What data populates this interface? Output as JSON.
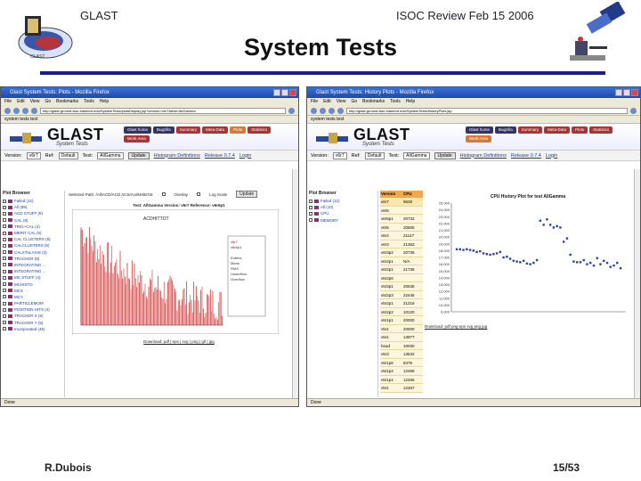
{
  "slide": {
    "header_left": "GLAST",
    "header_right": "ISOC Review Feb 15 2006",
    "title": "System Tests",
    "footer_author": "R.Dubois",
    "footer_page": "15/53"
  },
  "window1": {
    "title": "Glast System Tests: Plots - Mozilla Firefox",
    "menu": [
      "File",
      "Edit",
      "View",
      "Go",
      "Bookmarks",
      "Tools",
      "Help"
    ],
    "address": "http://glast-ground.slac.stanford.edu/SystemTests/plotsDisplay.jsp?version=v6r7&test=AllGamma",
    "bookmarks": "system tests test",
    "logo": "GLAST",
    "subtitle": "System Tests",
    "tabs": [
      "Glast home",
      "Bugzilla",
      "Summary",
      "Meta-Data",
      "Plots",
      "Statistics",
      "Work Area"
    ],
    "active_tab": "Plots",
    "controls": {
      "version_label": "Version:",
      "version_value": "v6r7",
      "ref_label": "Ref:",
      "ref_value": "Default",
      "test_label": "Test:",
      "test_value": "AllGamma",
      "update_button": "Update",
      "histo_link": "Histogram Definitions",
      "release_link": "Release 0.7.4",
      "login_link": "Login"
    },
    "browser_title": "Plot Browser",
    "browser_items": [
      "Failed (12)",
      "All (99)",
      "ACD STUFF (8)",
      "CAL (8)",
      "TRIG+CAL (4)",
      "MERIT CAL (5)",
      "CAL CLUSTERS (8)",
      "CALCLUSTERS (5)",
      "CALXTALAXIS (3)",
      "TRACKER (8)",
      "INTEGRATING ...",
      "INTEGRATING ...",
      "MC STUFF (4)",
      "MCHISTO",
      "MCX",
      "MCY",
      "PARTICLEMOM",
      "POSITION HITS (4)",
      "TRACKER X (5)",
      "TRACKER Y (5)",
      "Incorporated (45)"
    ],
    "selected_row": "Selected Path: /All/ACD/ACD ACS/AcdNHitsTot",
    "overlay_label": "Overlay",
    "logscale_label": "Log Scale",
    "update2_button": "Update",
    "plot_title": "Test: AllGamma  Version: v6r7  Reference: v6r6p1",
    "hist_name": "ACDHITTOT",
    "stats_labels": [
      "v6r7",
      "v6r6p1",
      "Entries",
      "Mean",
      "RMS",
      "Underflow",
      "Overflow"
    ],
    "download_text": "Download: pdf | eps | svg | png | gif | jpg",
    "status": "Done"
  },
  "window2": {
    "title": "Glast System Tests: History Plots - Mozilla Firefox",
    "menu": [
      "File",
      "Edit",
      "View",
      "Go",
      "Bookmarks",
      "Tools",
      "Help"
    ],
    "address": "http://glast-ground.slac.stanford.edu/SystemTests/historyPlots.jsp",
    "bookmarks": "system tests test",
    "logo": "GLAST",
    "subtitle": "System Tests",
    "tabs": [
      "Glast home",
      "Bugzilla",
      "Summary",
      "Meta-Data",
      "Plots",
      "Statistics",
      "Work Area"
    ],
    "active_tab": "Work Area",
    "controls": {
      "version_label": "Version:",
      "version_value": "v6r7",
      "ref_label": "Ref:",
      "ref_value": "Default",
      "test_label": "Test:",
      "test_value": "AllGamma",
      "update_button": "Update",
      "histo_link": "Histogram Definitions",
      "release_link": "Release 0.7.4",
      "login_link": "Login"
    },
    "browser_title": "Plot Browser",
    "browser_items": [
      "Failed (12)",
      "All (10)",
      "CPU",
      "MEMORY"
    ],
    "table_headers": [
      "Version",
      "CPU"
    ],
    "table_rows": [
      [
        "v6r7",
        "9628"
      ],
      [
        "v6r6",
        ""
      ],
      [
        "v6r5p1",
        "20732"
      ],
      [
        "v6r5",
        "20505"
      ],
      [
        "v6r4",
        "21147"
      ],
      [
        "v6r3",
        "21362"
      ],
      [
        "v6r3p2",
        "20736"
      ],
      [
        "v6r4p1",
        "N/A"
      ],
      [
        "v6r2p1",
        "21735"
      ],
      [
        "v6r2p6",
        ""
      ],
      [
        "v5r2p1",
        "20636"
      ],
      [
        "v5r2p3",
        "22446"
      ],
      [
        "v5r2p1",
        "21216"
      ],
      [
        "v5r2p2",
        "10120"
      ],
      [
        "v5r1p1",
        "20000"
      ],
      [
        "v5r1",
        "20000"
      ],
      [
        "v5r1",
        "13977"
      ],
      [
        "head",
        "10030"
      ],
      [
        "v5r3",
        "13632"
      ],
      [
        "v5r1p6",
        "8476"
      ],
      [
        "v5r1p4",
        "12466"
      ],
      [
        "v5r1p1",
        "12466"
      ],
      [
        "v5r1",
        "12467"
      ]
    ],
    "chart_title": "CPU History Plot for test AllGamma",
    "y_ticks": [
      "25,000",
      "24,000",
      "23,000",
      "22,000",
      "21,000",
      "20,000",
      "19,000",
      "18,000",
      "17,000",
      "16,000",
      "15,000",
      "14,000",
      "13,000",
      "12,000",
      "11,000",
      "10,000",
      "9,000"
    ],
    "download_text": "Download: pdf png eps svg png jpg",
    "status": "Done"
  },
  "chart_data": [
    {
      "type": "scatter",
      "title": "CPU History Plot for test AllGamma",
      "ylim": [
        9000,
        25000
      ],
      "x": [
        1,
        2,
        3,
        4,
        5,
        6,
        7,
        8,
        9,
        10,
        11,
        12,
        13,
        14,
        15,
        16,
        17,
        18,
        19,
        20,
        21,
        22,
        23,
        24,
        25,
        26,
        27,
        28,
        29,
        30,
        31,
        32,
        33,
        34,
        35,
        36,
        37,
        38,
        39,
        40,
        41,
        42,
        43,
        44,
        45,
        46,
        47,
        48,
        49,
        50
      ],
      "values": [
        18200,
        18200,
        18100,
        18200,
        18100,
        18000,
        17800,
        17900,
        17600,
        17500,
        17400,
        17500,
        17600,
        17800,
        17000,
        17100,
        16800,
        16500,
        16400,
        16300,
        16500,
        16100,
        16000,
        16200,
        16600,
        22400,
        21800,
        22600,
        21800,
        21400,
        21600,
        21400,
        19300,
        19800,
        17400,
        16400,
        16300,
        16300,
        16600,
        16000,
        16200,
        15800,
        16900,
        16000,
        16500,
        16200,
        15600,
        15800,
        16200,
        15400
      ]
    },
    {
      "type": "line",
      "title": "ACDHITTOT",
      "series": [
        {
          "name": "v6r7"
        },
        {
          "name": "v6r6p1"
        }
      ]
    }
  ]
}
